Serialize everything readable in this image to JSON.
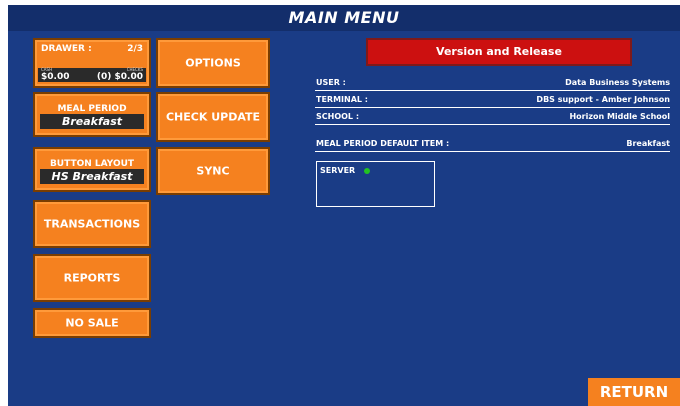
{
  "header": {
    "title": "MAIN MENU"
  },
  "drawer": {
    "label": "DRAWER :",
    "count": "2/3",
    "cash_caption": "CASH",
    "check_caption": "CHECKS",
    "cash": "$0.00",
    "checks": "(0) $0.00"
  },
  "buttons": {
    "options": "OPTIONS",
    "meal_period_label": "MEAL PERIOD",
    "meal_period_value": "Breakfast",
    "check_update": "CHECK UPDATE",
    "button_layout_label": "BUTTON LAYOUT",
    "button_layout_value": "HS Breakfast",
    "sync": "SYNC",
    "transactions": "TRANSACTIONS",
    "reports": "REPORTS",
    "no_sale": "NO SALE",
    "return": "RETURN"
  },
  "version": {
    "label": "Version and Release"
  },
  "info": {
    "user_label": "USER :",
    "user_value": "Data Business Systems",
    "terminal_label": "TERMINAL :",
    "terminal_value": "DBS support - Amber Johnson",
    "school_label": "SCHOOL :",
    "school_value": "Horizon Middle School",
    "meal_default_label": "MEAL PERIOD DEFAULT ITEM :",
    "meal_default_value": "Breakfast"
  },
  "server": {
    "label": "SERVER",
    "status_color": "#22c322"
  },
  "colors": {
    "background": "#1a3c86",
    "title_bar": "#132e6b",
    "button": "#f5811f",
    "version": "#cc1010"
  }
}
